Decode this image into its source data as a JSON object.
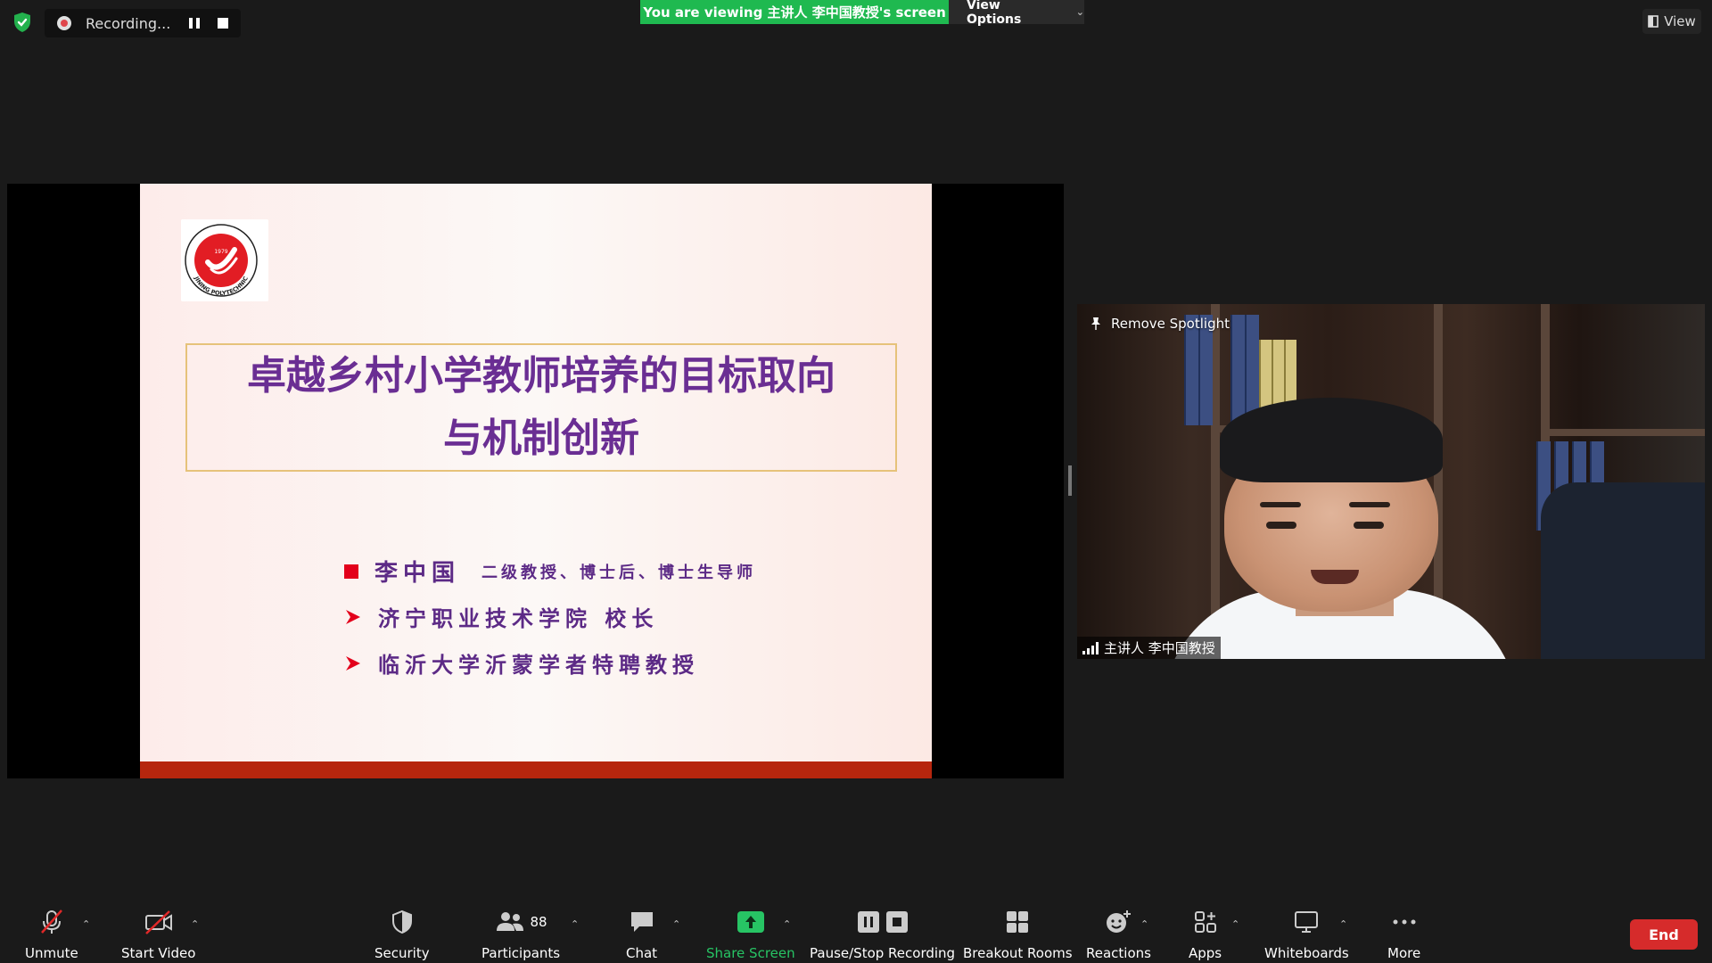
{
  "recording": {
    "label": "Recording..."
  },
  "banner": {
    "viewing_text": "You are viewing 主讲人 李中国教授's screen",
    "view_options": "View Options"
  },
  "view_button": {
    "label": "View"
  },
  "slide": {
    "title_line1": "卓越乡村小学教师培养的目标取向",
    "title_line2": "与机制创新",
    "bullets": [
      {
        "name": "李中国",
        "detail": "二级教授、博士后、博士生导师"
      },
      {
        "text": "济宁职业技术学院  校长"
      },
      {
        "text": "临沂大学沂蒙学者特聘教授"
      }
    ],
    "logo_year": "1979",
    "logo_text": "JINING POLYTECHNIC"
  },
  "video": {
    "remove_spotlight": "Remove Spotlight",
    "speaker_name": "主讲人 李中国教授"
  },
  "toolbar": {
    "unmute": "Unmute",
    "start_video": "Start Video",
    "security": "Security",
    "participants": "Participants",
    "participants_count": "88",
    "chat": "Chat",
    "share_screen": "Share Screen",
    "pause_stop_recording": "Pause/Stop Recording",
    "breakout_rooms": "Breakout Rooms",
    "reactions": "Reactions",
    "apps": "Apps",
    "whiteboards": "Whiteboards",
    "more": "More",
    "end": "End"
  },
  "colors": {
    "banner_green": "#1fb950",
    "share_green": "#27c464",
    "end_red": "#d62b2b",
    "slide_title_purple": "#6a2e93",
    "slide_accent_red": "#e3001b",
    "slide_bottom_bar": "#b6260e"
  }
}
